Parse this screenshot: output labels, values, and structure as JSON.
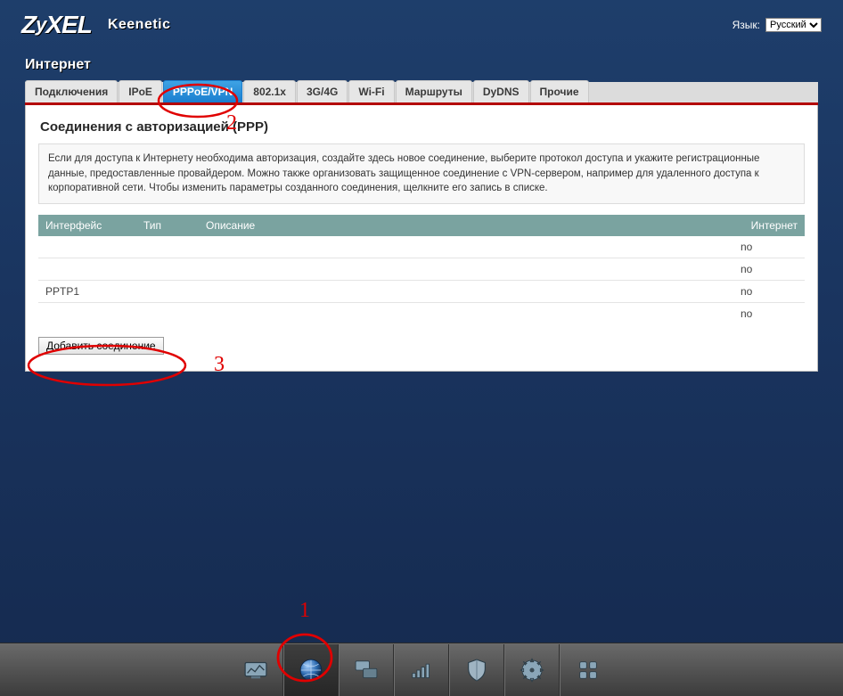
{
  "brand": "ZyXEL",
  "model": "Keenetic",
  "lang_label": "Язык:",
  "lang_options": [
    "Русский"
  ],
  "page_title": "Интернет",
  "tabs": [
    {
      "label": "Подключения",
      "active": false
    },
    {
      "label": "IPoE",
      "active": false
    },
    {
      "label": "PPPoE/VPN",
      "active": true
    },
    {
      "label": "802.1x",
      "active": false
    },
    {
      "label": "3G/4G",
      "active": false
    },
    {
      "label": "Wi-Fi",
      "active": false
    },
    {
      "label": "Маршруты",
      "active": false
    },
    {
      "label": "DyDNS",
      "active": false
    },
    {
      "label": "Прочие",
      "active": false
    }
  ],
  "section_title": "Соединения с авторизацией (PPP)",
  "section_desc": "Если для доступа к Интернету необходима авторизация, создайте здесь новое соединение, выберите протокол доступа и укажите регистрационные данные, предоставленные провайдером. Можно также организовать защищенное соединение с VPN-сервером, например для удаленного доступа к корпоративной сети. Чтобы изменить параметры созданного соединения, щелкните его запись в списке.",
  "table": {
    "headers": {
      "iface": "Интерфейс",
      "type": "Тип",
      "desc": "Описание",
      "inet": "Интернет"
    },
    "rows": [
      {
        "iface": "",
        "type": "",
        "desc": "",
        "inet": "no"
      },
      {
        "iface": "",
        "type": "",
        "desc": "",
        "inet": "no"
      },
      {
        "iface": "PPTP1",
        "type": "",
        "desc": "",
        "inet": "no"
      },
      {
        "iface": "",
        "type": "",
        "desc": "",
        "inet": "no"
      }
    ]
  },
  "add_button": "Добавить соединение",
  "annotations": {
    "n1": "1",
    "n2": "2",
    "n3": "3"
  },
  "dock": [
    "monitor",
    "globe",
    "displays",
    "signal",
    "shield",
    "gear",
    "apps"
  ]
}
